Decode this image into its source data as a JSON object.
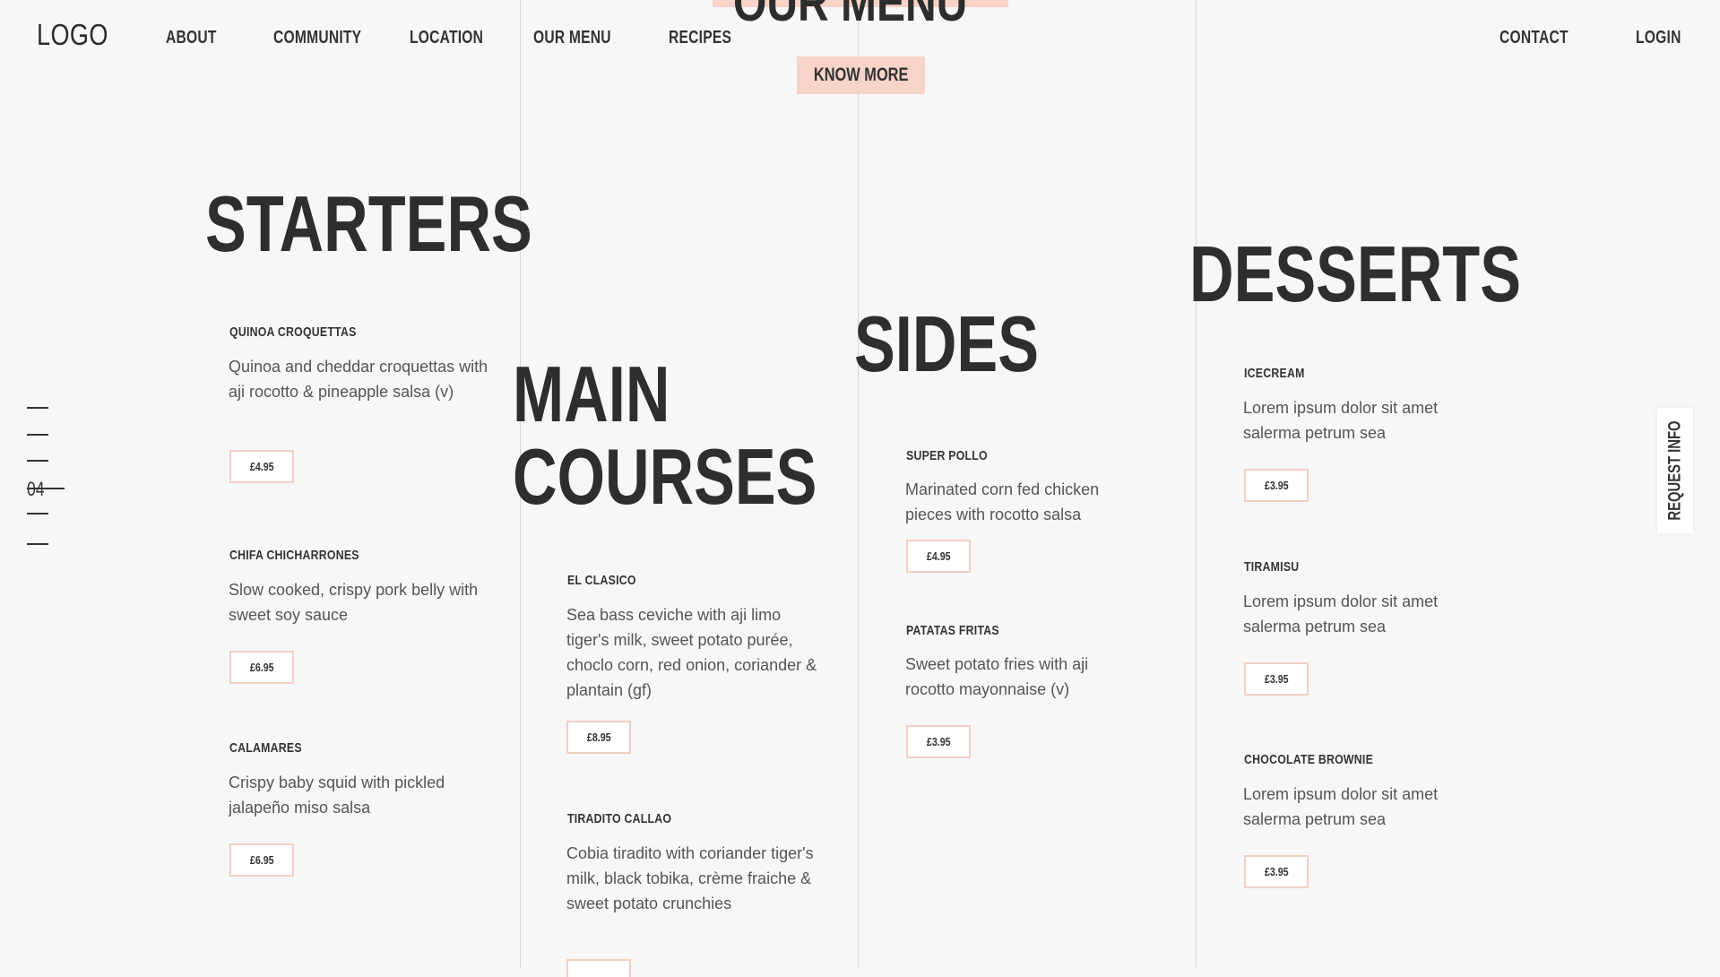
{
  "header": {
    "logo": "LOGO",
    "nav": {
      "about": "ABOUT",
      "community": "COMMUNITY",
      "location": "LOCATION",
      "our_menu": "OUR MENU",
      "recipes": "RECIPES",
      "contact": "CONTACT",
      "login": "LOGIN"
    }
  },
  "hero": {
    "title": "OUR MENU",
    "button": "KNOW MORE"
  },
  "pager": {
    "current": "04"
  },
  "request_info": "REQUEST INFO",
  "colors": {
    "accent": "#f7d3c8",
    "background": "#f7f7f7",
    "text": "#2e2e2e",
    "divider": "#d6d6d6"
  },
  "sections": {
    "starters": {
      "title": "STARTERS",
      "items": [
        {
          "name": "QUINOA CROQUETTAS",
          "desc": "Quinoa and cheddar croquettas with aji rocotto & pineapple salsa (v)",
          "price": "£4.95"
        },
        {
          "name": "CHIFA CHICHARRONES",
          "desc": "Slow cooked, crispy pork belly with sweet soy sauce",
          "price": "£6.95"
        },
        {
          "name": "CALAMARES",
          "desc": "Crispy baby squid with pickled jalapeño miso salsa",
          "price": "£6.95"
        }
      ]
    },
    "mains": {
      "title_line1": "MAIN",
      "title_line2": "COURSES",
      "items": [
        {
          "name": "EL CLASICO",
          "desc": "Sea bass ceviche with aji limo tiger's milk, sweet potato purée, choclo corn, red onion, coriander & plantain (gf)",
          "price": "£8.95"
        },
        {
          "name": "TIRADITO CALLAO",
          "desc": "Cobia tiradito with coriander tiger's milk, black tobika, crème fraiche & sweet potato crunchies"
        }
      ]
    },
    "sides": {
      "title": "SIDES",
      "items": [
        {
          "name": "SUPER POLLO",
          "desc": "Marinated corn fed chicken pieces with rocotto salsa",
          "price": "£4.95"
        },
        {
          "name": "PATATAS FRITAS",
          "desc": "Sweet potato fries with aji rocotto mayonnaise (v)",
          "price": "£3.95"
        }
      ]
    },
    "desserts": {
      "title": "DESSERTS",
      "items": [
        {
          "name": "ICECREAM",
          "desc": "Lorem ipsum dolor sit amet salerma petrum sea",
          "price": "£3.95"
        },
        {
          "name": "TIRAMISU",
          "desc": "Lorem ipsum dolor sit amet salerma petrum sea",
          "price": "£3.95"
        },
        {
          "name": "CHOCOLATE BROWNIE",
          "desc": "Lorem ipsum dolor sit amet salerma petrum sea",
          "price": "£3.95"
        }
      ]
    }
  }
}
